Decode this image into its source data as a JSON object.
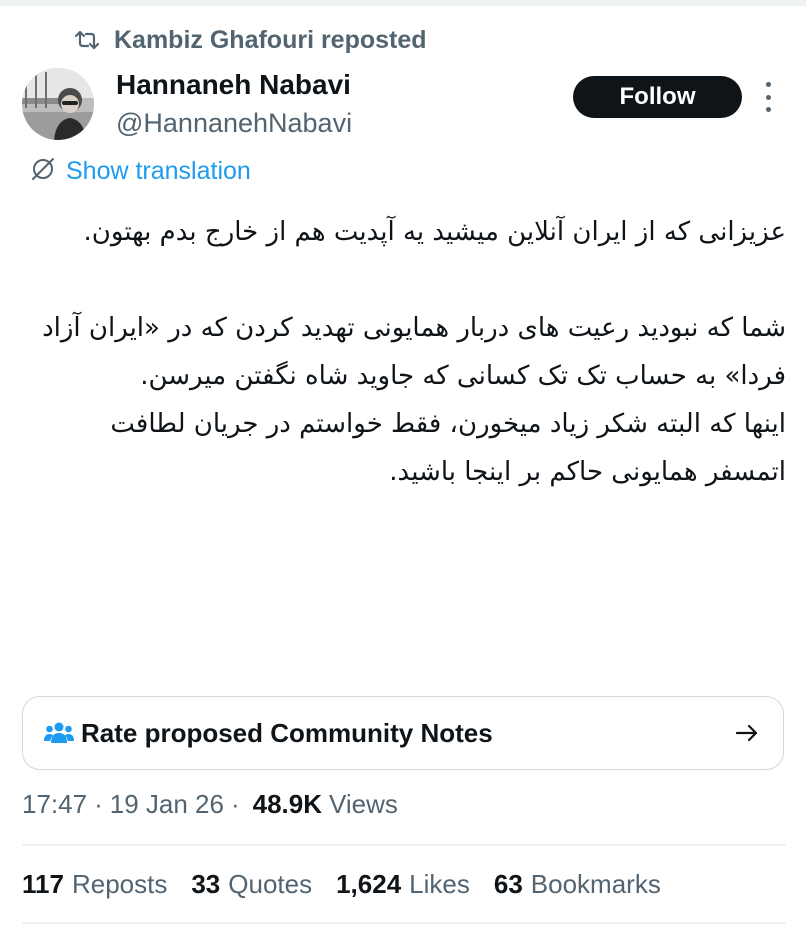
{
  "repost": {
    "icon": "repost-icon",
    "text": "Kambiz Ghafouri reposted"
  },
  "author": {
    "display_name": "Hannaneh Nabavi",
    "handle": "@HannanehNabavi",
    "follow_label": "Follow"
  },
  "translation": {
    "icon": "translate-icon",
    "label": "Show translation"
  },
  "tweet": {
    "paragraphs": [
      "عزیزانی که از ایران آنلاین میشید یه آپدیت هم از خارج بدم بهتون.",
      "",
      "شما که نبودید رعیت های دربار همایونی تهدید کردن که در «ایران آزاد فردا» به حساب تک تک کسانی که جاوید شاه نگفتن میرسن.",
      "اینها که البته شکر زیاد میخورن، فقط خواستم در جریان لطافت اتمسفر همایونی حاکم بر اینجا باشید."
    ]
  },
  "community_notes": {
    "icon": "people-icon",
    "label": "Rate proposed Community Notes",
    "arrow_icon": "arrow-right-icon"
  },
  "meta": {
    "time": "17:47",
    "separator": "·",
    "date": "19 Jan 26",
    "views_count": "48.9K",
    "views_label": "Views"
  },
  "stats": {
    "reposts_count": "117",
    "reposts_label": "Reposts",
    "quotes_count": "33",
    "quotes_label": "Quotes",
    "likes_count": "1,624",
    "likes_label": "Likes",
    "bookmarks_count": "63",
    "bookmarks_label": "Bookmarks"
  },
  "colors": {
    "text_primary": "#0f1419",
    "text_secondary": "#536471",
    "link_blue": "#1d9bf0",
    "border": "#cfd9de",
    "divider": "#eff3f4"
  }
}
